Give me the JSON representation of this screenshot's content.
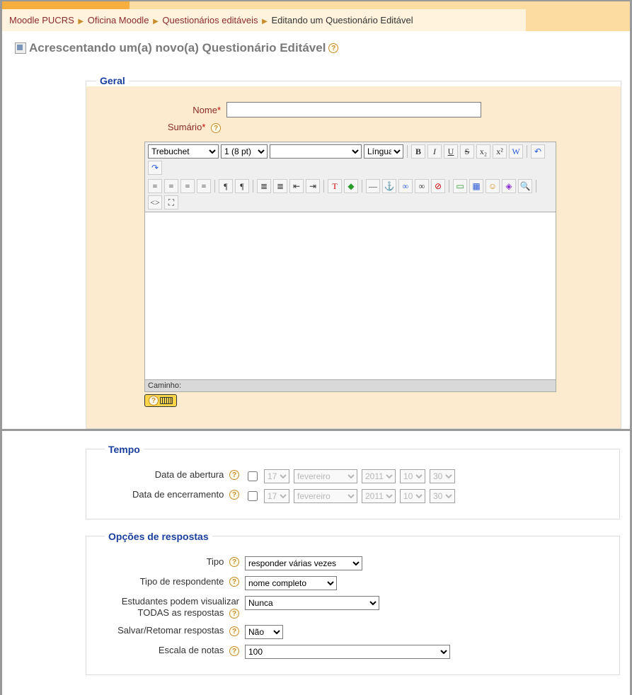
{
  "breadcrumb": {
    "items": [
      "Moodle PUCRS",
      "Oficina Moodle",
      "Questionários editáveis"
    ],
    "current": "Editando um Questionário Editável"
  },
  "heading": "Acrescentando um(a) novo(a) Questionário Editável",
  "sections": {
    "geral": {
      "legend": "Geral",
      "nome_label": "Nome",
      "nome_value": "",
      "sumario_label": "Sumário",
      "editor": {
        "font": "Trebuchet",
        "size": "1 (8 pt)",
        "style_value": "",
        "lang": "Língua",
        "path_label": "Caminho:"
      }
    },
    "tempo": {
      "legend": "Tempo",
      "abertura_label": "Data de abertura",
      "encerramento_label": "Data de encerramento",
      "day": "17",
      "month": "fevereiro",
      "year": "2011",
      "hour": "10",
      "minute": "30"
    },
    "opcoes": {
      "legend": "Opções de respostas",
      "tipo_label": "Tipo",
      "tipo_value": "responder várias vezes",
      "respondente_label": "Tipo de respondente",
      "respondente_value": "nome completo",
      "visualizar_label": "Estudantes podem visualizar TODAS as respostas",
      "visualizar_value": "Nunca",
      "salvar_label": "Salvar/Retomar respostas",
      "salvar_value": "Não",
      "escala_label": "Escala de notas",
      "escala_value": "100"
    }
  },
  "toolbar_glyphs": {
    "bold": "B",
    "italic": "I",
    "underline": "U",
    "strike": "S",
    "sub": "x₂",
    "sup": "x²",
    "clean": "W",
    "undo": "↶",
    "redo": "↷",
    "al": "≡",
    "ac": "≡",
    "ar": "≡",
    "aj": "≡",
    "ltr": "¶",
    "rtl": "¶",
    "ol": "≣",
    "ul": "≣",
    "out": "⇤",
    "ind": "⇥",
    "fontcolor": "T",
    "bgcolor": "◆",
    "hr": "—",
    "anchor": "⚓",
    "link": "∞",
    "unlink": "∞",
    "nolink": "⊘",
    "img": "▭",
    "table": "▦",
    "smile": "☺",
    "char": "◈",
    "find": "🔍",
    "html": "<>",
    "full": "⛶"
  }
}
